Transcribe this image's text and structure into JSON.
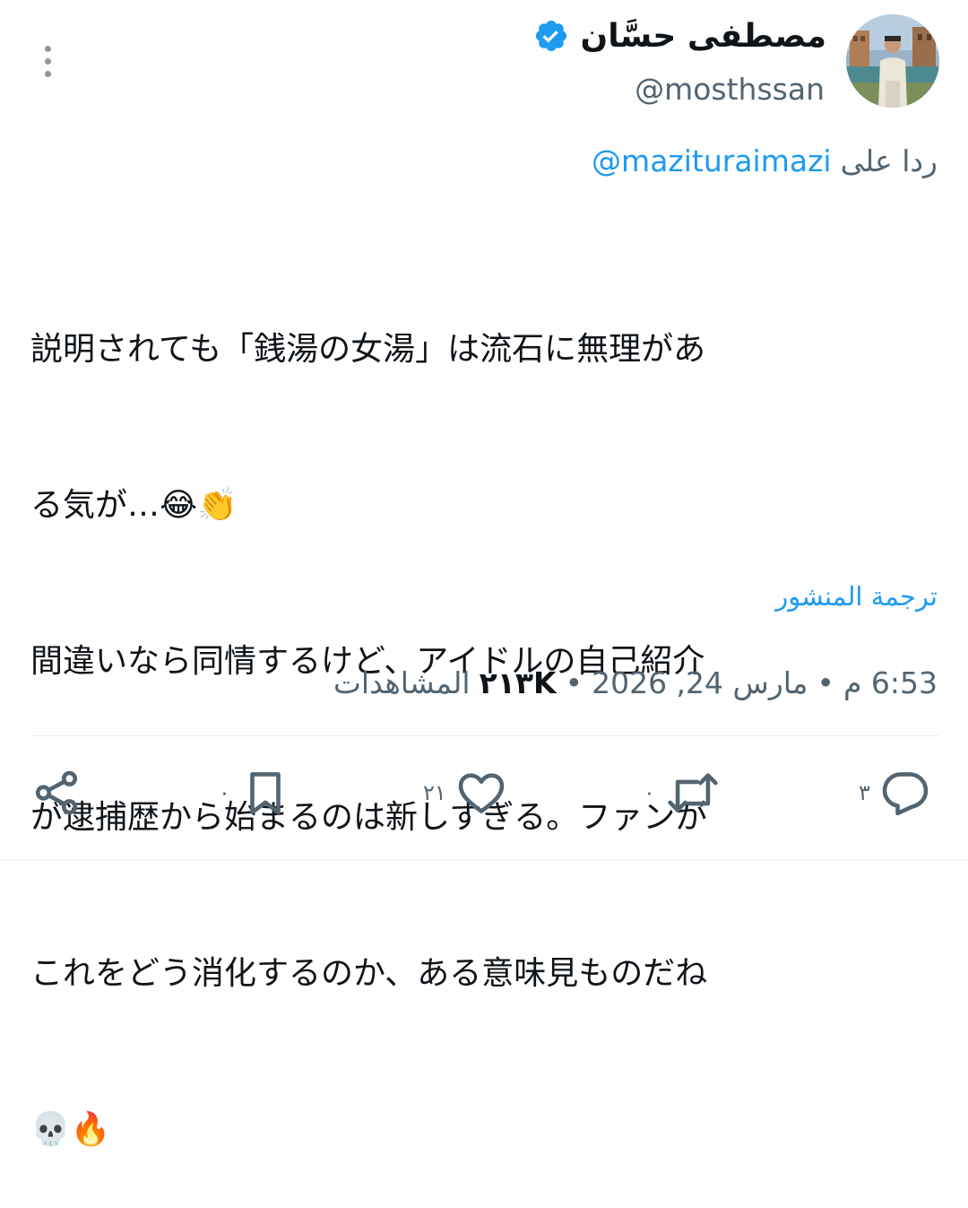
{
  "author": {
    "display_name": "مصطفى حسَّان",
    "handle": "@mosthssan",
    "verified": true,
    "verified_color": "#1d9bf0"
  },
  "reply_to": {
    "prefix": "ردا على",
    "mention": "@mazituraimazi"
  },
  "tweet": {
    "lines": [
      "説明されても「銭湯の女湯」は流石に無理があ",
      "る気が…😂👏",
      "間違いなら同情するけど、アイドルの自己紹介",
      "が逮捕歴から始まるのは新しすぎる。ファンが",
      "これをどう消化するのか、ある意味見ものだね",
      "💀🔥"
    ]
  },
  "translate_label": "ترجمة المنشور",
  "meta": {
    "time": "6:53 م",
    "date": "مارس 24, 2026",
    "separator": "•",
    "views_count": "٢١٣K",
    "views_label": "المشاهدات"
  },
  "actions": {
    "reply": {
      "icon": "reply-icon",
      "count": "٣"
    },
    "retweet": {
      "icon": "retweet-icon",
      "count": "٠"
    },
    "like": {
      "icon": "heart-icon",
      "count": "٢١"
    },
    "bookmark": {
      "icon": "bookmark-icon",
      "count": "٠"
    },
    "share": {
      "icon": "share-icon"
    }
  },
  "colors": {
    "accent": "#1d9bf0",
    "text_primary": "#0f1419",
    "text_secondary": "#536471",
    "divider": "#e7e9ea"
  }
}
